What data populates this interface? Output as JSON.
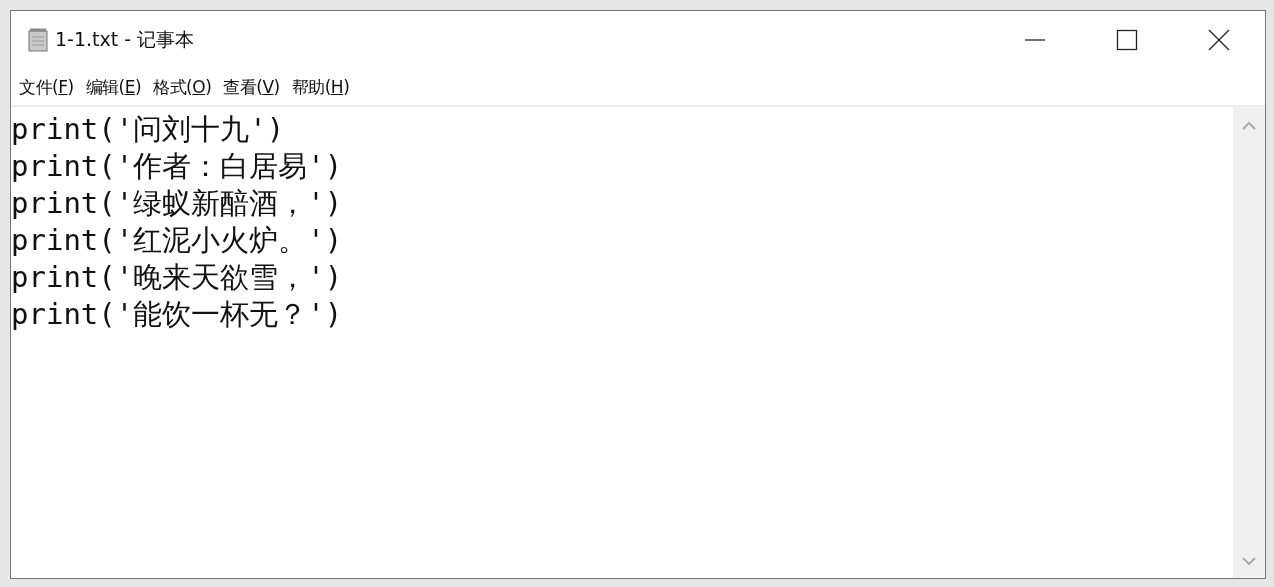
{
  "window": {
    "title": "1-1.txt - 记事本"
  },
  "menu": [
    {
      "before": "文件(",
      "key": "F",
      "after": ")"
    },
    {
      "before": "编辑(",
      "key": "E",
      "after": ")"
    },
    {
      "before": "格式(",
      "key": "O",
      "after": ")"
    },
    {
      "before": "查看(",
      "key": "V",
      "after": ")"
    },
    {
      "before": "帮助(",
      "key": "H",
      "after": ")"
    }
  ],
  "editor": {
    "lines": [
      "print('问刘十九')",
      "print('作者：白居易')",
      "print('绿蚁新醅酒，')",
      "print('红泥小火炉。')",
      "print('晚来天欲雪，')",
      "print('能饮一杯无？')"
    ]
  }
}
